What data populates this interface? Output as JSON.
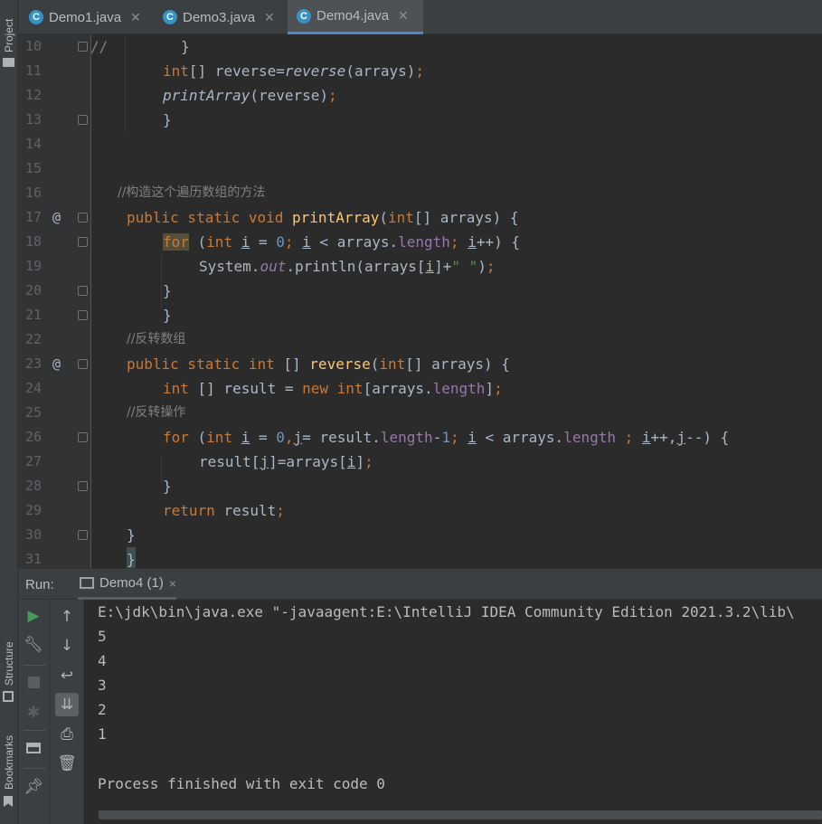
{
  "side_panels": {
    "project_label": "Project",
    "structure_label": "Structure",
    "bookmarks_label": "Bookmarks"
  },
  "tabs": [
    {
      "icon": "java-class-icon",
      "label": "Demo1.java",
      "active": false
    },
    {
      "icon": "java-class-icon",
      "label": "Demo3.java",
      "active": false
    },
    {
      "icon": "java-class-icon",
      "label": "Demo4.java",
      "active": true
    }
  ],
  "editor": {
    "line_numbers": [
      "10",
      "11",
      "12",
      "13",
      "14",
      "15",
      "16",
      "17",
      "18",
      "19",
      "20",
      "21",
      "22",
      "23",
      "24",
      "25",
      "26",
      "27",
      "28",
      "29",
      "30",
      "31"
    ],
    "gutter_marks": {
      "17": "@",
      "23": "@"
    },
    "lines": {
      "10a": "//",
      "10b": "}",
      "11_type": "int",
      "11_rest": "[] reverse=",
      "11_call": "reverse",
      "11_args": "(arrays)",
      "11_semi": ";",
      "12_call": "printArray",
      "12_args": "(reverse)",
      "12_semi": ";",
      "13": "}",
      "16": "//构造这个遍历数组的方法",
      "17_mods": "public static void ",
      "17_name": "printArray",
      "17_p1": "(",
      "17_int": "int",
      "17_p2": "[] arrays) {",
      "18_for": "for",
      "18_a": " (",
      "18_int": "int ",
      "18_i": "i",
      "18_b": " = ",
      "18_zero": "0",
      "18_semi1": "; ",
      "18_i2": "i",
      "18_c": " < arrays.",
      "18_len": "length",
      "18_semi2": "; ",
      "18_i3": "i",
      "18_d": "++) {",
      "19_a": "System.",
      "19_out": "out",
      "19_b": ".println(arrays[",
      "19_i": "i",
      "19_c": "]+",
      "19_str": "\" \"",
      "19_d": ")",
      "19_semi": ";",
      "20": "}",
      "21": "}",
      "22": "//反转数组",
      "23_mods": "public static int ",
      "23_br": "[] ",
      "23_name": "reverse",
      "23_p1": "(",
      "23_int": "int",
      "23_p2": "[] arrays) {",
      "24_int": "int ",
      "24_a": "[] result = ",
      "24_new": "new ",
      "24_int2": "int",
      "24_b": "[arrays.",
      "24_len": "length",
      "24_c": "]",
      "24_semi": ";",
      "25": "//反转操作",
      "26_for": "for",
      "26_a": " (",
      "26_int": "int ",
      "26_i": "i",
      "26_b": " = ",
      "26_zero": "0",
      "26_comma": ",",
      "26_j": "j",
      "26_c": "= result.",
      "26_len": "length",
      "26_minus": "-",
      "26_one": "1",
      "26_semi1": "; ",
      "26_i2": "i",
      "26_d": " < arrays.",
      "26_len2": "length",
      "26_semi2": " ; ",
      "26_i3": "i",
      "26_e": "++,",
      "26_j2": "j",
      "26_f": "--) {",
      "27_a": "result[",
      "27_j": "j",
      "27_b": "]=arrays[",
      "27_i": "i",
      "27_c": "]",
      "27_semi": ";",
      "28": "}",
      "29_ret": "return ",
      "29_a": "result",
      "29_semi": ";",
      "30": "}",
      "31": "}"
    }
  },
  "run_panel": {
    "title": "Run:",
    "tab_label": "Demo4 (1)",
    "tab_close": "×",
    "toolbar_left": [
      "run-icon",
      "wrench-icon",
      "stop-icon",
      "debug-disabled-icon",
      "layout-icon",
      "pin-icon"
    ],
    "toolbar_right": [
      "arrow-up-icon",
      "arrow-down-icon",
      "soft-wrap-icon",
      "scroll-to-end-icon",
      "print-icon",
      "trash-icon"
    ],
    "console_lines": [
      "E:\\jdk\\bin\\java.exe \"-javaagent:E:\\IntelliJ IDEA Community Edition 2021.3.2\\lib\\",
      "5",
      "4",
      "3",
      "2",
      "1",
      "",
      "Process finished with exit code 0"
    ]
  },
  "colors": {
    "keyword": "#cc7832",
    "method": "#ffc66d",
    "number": "#6897bb",
    "string": "#6a8759",
    "field": "#9876aa",
    "comment": "#808080",
    "text": "#a9b7c6",
    "accent": "#4a88c7",
    "run_green": "#499c54"
  }
}
